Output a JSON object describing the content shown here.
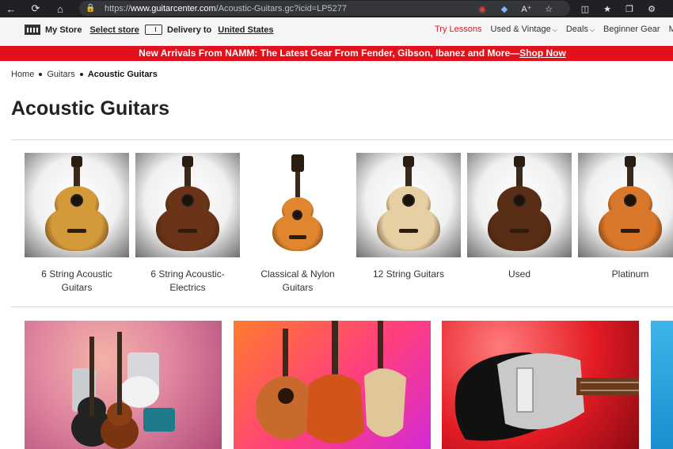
{
  "browser": {
    "url_prefix": "https://",
    "url_host": "www.guitarcenter.com",
    "url_path": "/Acoustic-Guitars.gc?icid=LP5277"
  },
  "utility_bar": {
    "my_store_label": "My Store",
    "select_store_label": "Select store",
    "delivery_label": "Delivery to",
    "delivery_location": "United States",
    "links": [
      "Try Lessons",
      "Used & Vintage",
      "Deals",
      "Beginner Gear",
      "M"
    ]
  },
  "promo": {
    "text": "New Arrivals From NAMM: The Latest Gear From Fender, Gibson, Ibanez and More—",
    "link": "Shop Now"
  },
  "breadcrumb": [
    "Home",
    "Guitars",
    "Acoustic Guitars"
  ],
  "page_title": "Acoustic Guitars",
  "categories": [
    {
      "label": "6 String Acoustic Guitars",
      "body_color": "#d49a3a"
    },
    {
      "label": "6 String Acoustic-Electrics",
      "body_color": "#6b3418"
    },
    {
      "label": "Classical & Nylon Guitars",
      "body_color": "#e0862e"
    },
    {
      "label": "12 String Guitars",
      "body_color": "#e6cfa3"
    },
    {
      "label": "Used",
      "body_color": "#5a2e14"
    },
    {
      "label": "Platinum",
      "body_color": "#d9772a"
    }
  ]
}
